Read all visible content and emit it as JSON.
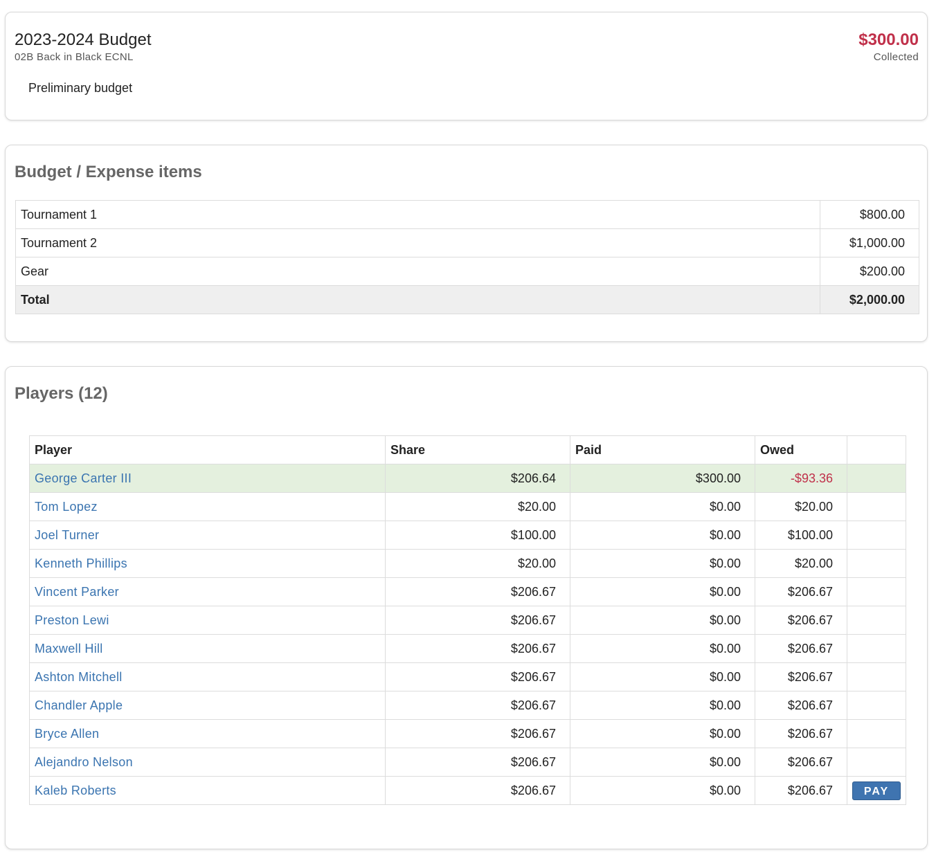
{
  "summary": {
    "title": "2023-2024 Budget",
    "team": "02B Back in Black ECNL",
    "description": "Preliminary budget",
    "collected_amount": "$300.00",
    "collected_label": "Collected"
  },
  "expenses": {
    "title": "Budget / Expense items",
    "items": [
      {
        "name": "Tournament 1",
        "amount": "$800.00"
      },
      {
        "name": "Tournament 2",
        "amount": "$1,000.00"
      },
      {
        "name": "Gear",
        "amount": "$200.00"
      }
    ],
    "total_label": "Total",
    "total_amount": "$2,000.00"
  },
  "players": {
    "title": "Players (12)",
    "headers": {
      "player": "Player",
      "share": "Share",
      "paid": "Paid",
      "owed": "Owed"
    },
    "pay_label": "PAY",
    "rows": [
      {
        "name": "George Carter III",
        "share": "$206.64",
        "paid": "$300.00",
        "owed": "-$93.36"
      },
      {
        "name": "Tom Lopez",
        "share": "$20.00",
        "paid": "$0.00",
        "owed": "$20.00"
      },
      {
        "name": "Joel Turner",
        "share": "$100.00",
        "paid": "$0.00",
        "owed": "$100.00"
      },
      {
        "name": "Kenneth Phillips",
        "share": "$20.00",
        "paid": "$0.00",
        "owed": "$20.00"
      },
      {
        "name": "Vincent Parker",
        "share": "$206.67",
        "paid": "$0.00",
        "owed": "$206.67"
      },
      {
        "name": "Preston Lewi",
        "share": "$206.67",
        "paid": "$0.00",
        "owed": "$206.67"
      },
      {
        "name": "Maxwell Hill",
        "share": "$206.67",
        "paid": "$0.00",
        "owed": "$206.67"
      },
      {
        "name": "Ashton Mitchell",
        "share": "$206.67",
        "paid": "$0.00",
        "owed": "$206.67"
      },
      {
        "name": "Chandler Apple",
        "share": "$206.67",
        "paid": "$0.00",
        "owed": "$206.67"
      },
      {
        "name": "Bryce Allen",
        "share": "$206.67",
        "paid": "$0.00",
        "owed": "$206.67"
      },
      {
        "name": "Alejandro Nelson",
        "share": "$206.67",
        "paid": "$0.00",
        "owed": "$206.67"
      },
      {
        "name": "Kaleb Roberts",
        "share": "$206.67",
        "paid": "$0.00",
        "owed": "$206.67"
      }
    ]
  },
  "colors": {
    "accent_red": "#c0304a",
    "link_blue": "#3a74b0",
    "highlight_green": "#e4f0de",
    "pay_button": "#3f74b0"
  }
}
